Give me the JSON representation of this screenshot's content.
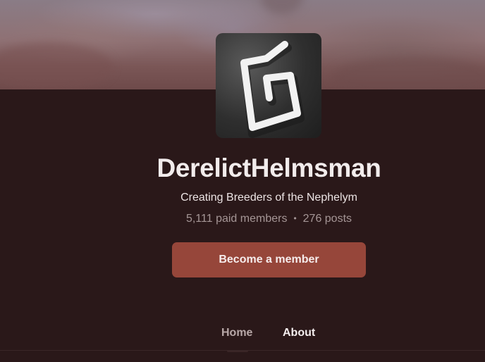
{
  "creator": {
    "name": "DerelictHelmsman",
    "tagline": "Creating Breeders of the Nephelym",
    "paid_members": "5,111 paid members",
    "posts": "276 posts",
    "separator": "•"
  },
  "cta": {
    "label": "Become a member"
  },
  "tabs": [
    {
      "label": "Home"
    },
    {
      "label": "About"
    }
  ],
  "colors": {
    "background": "#2a1819",
    "button": "#96463a",
    "text_primary": "#f2ecec",
    "text_muted": "#a59696"
  },
  "icons": {
    "avatar": "stylized-g-logo"
  }
}
